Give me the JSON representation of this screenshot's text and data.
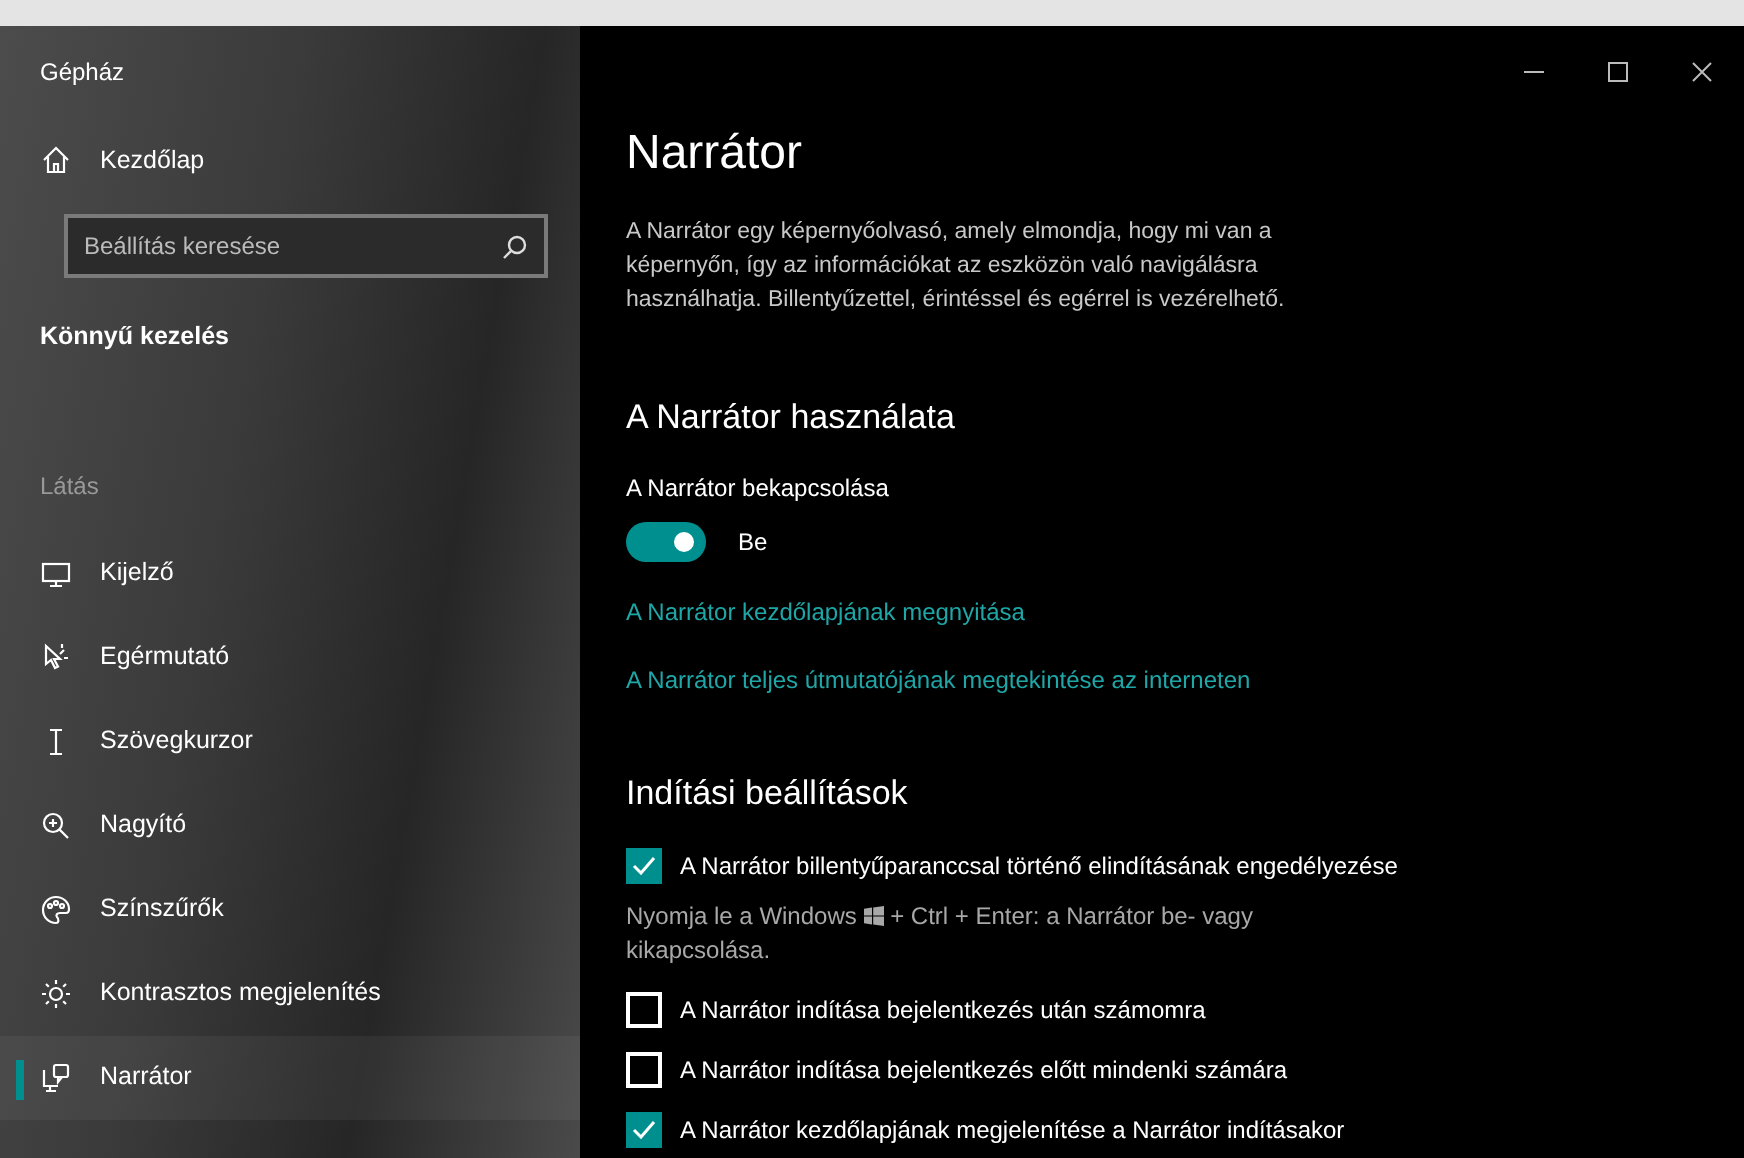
{
  "window": {
    "title": "Gépház"
  },
  "sidebar": {
    "home": "Kezdőlap",
    "search": {
      "placeholder": "Beállítás keresése"
    },
    "category": "Könnyű kezelés",
    "section": "Látás",
    "items": [
      {
        "label": "Kijelző",
        "kind": "display",
        "selected": false
      },
      {
        "label": "Egérmutató",
        "kind": "pointer",
        "selected": false
      },
      {
        "label": "Szövegkurzor",
        "kind": "cursor",
        "selected": false
      },
      {
        "label": "Nagyító",
        "kind": "magnifier",
        "selected": false
      },
      {
        "label": "Színszűrők",
        "kind": "palette",
        "selected": false
      },
      {
        "label": "Kontrasztos megjelenítés",
        "kind": "contrast",
        "selected": false
      },
      {
        "label": "Narrátor",
        "kind": "narrator",
        "selected": true
      }
    ]
  },
  "main": {
    "title": "Narrátor",
    "description": "A Narrátor egy képernyőolvasó, amely elmondja, hogy mi van a képernyőn, így az információkat az eszközön való navigálásra használhatja. Billentyűzettel, érintéssel és egérrel is vezérelhető.",
    "use_section": {
      "heading": "A Narrátor használata",
      "toggle": {
        "label": "A Narrátor bekapcsolása",
        "on": true,
        "state_text": "Be"
      },
      "links": [
        "A Narrátor kezdőlapjának megnyitása",
        "A Narrátor teljes útmutatójának megtekintése az interneten"
      ]
    },
    "startup_section": {
      "heading": "Indítási beállítások",
      "options": [
        {
          "label": "A Narrátor billentyűparanccsal történő elindításának engedélyezése",
          "checked": true,
          "hint_before": "Nyomja le a Windows",
          "hint_after": "+ Ctrl + Enter: a Narrátor be- vagy",
          "hint_end": "kikapcsolása."
        },
        {
          "label": "A Narrátor indítása bejelentkezés után számomra",
          "checked": false
        },
        {
          "label": "A Narrátor indítása bejelentkezés előtt mindenki számára",
          "checked": false
        },
        {
          "label": "A Narrátor kezdőlapjának megjelenítése a Narrátor indításakor",
          "checked": true
        }
      ]
    }
  }
}
